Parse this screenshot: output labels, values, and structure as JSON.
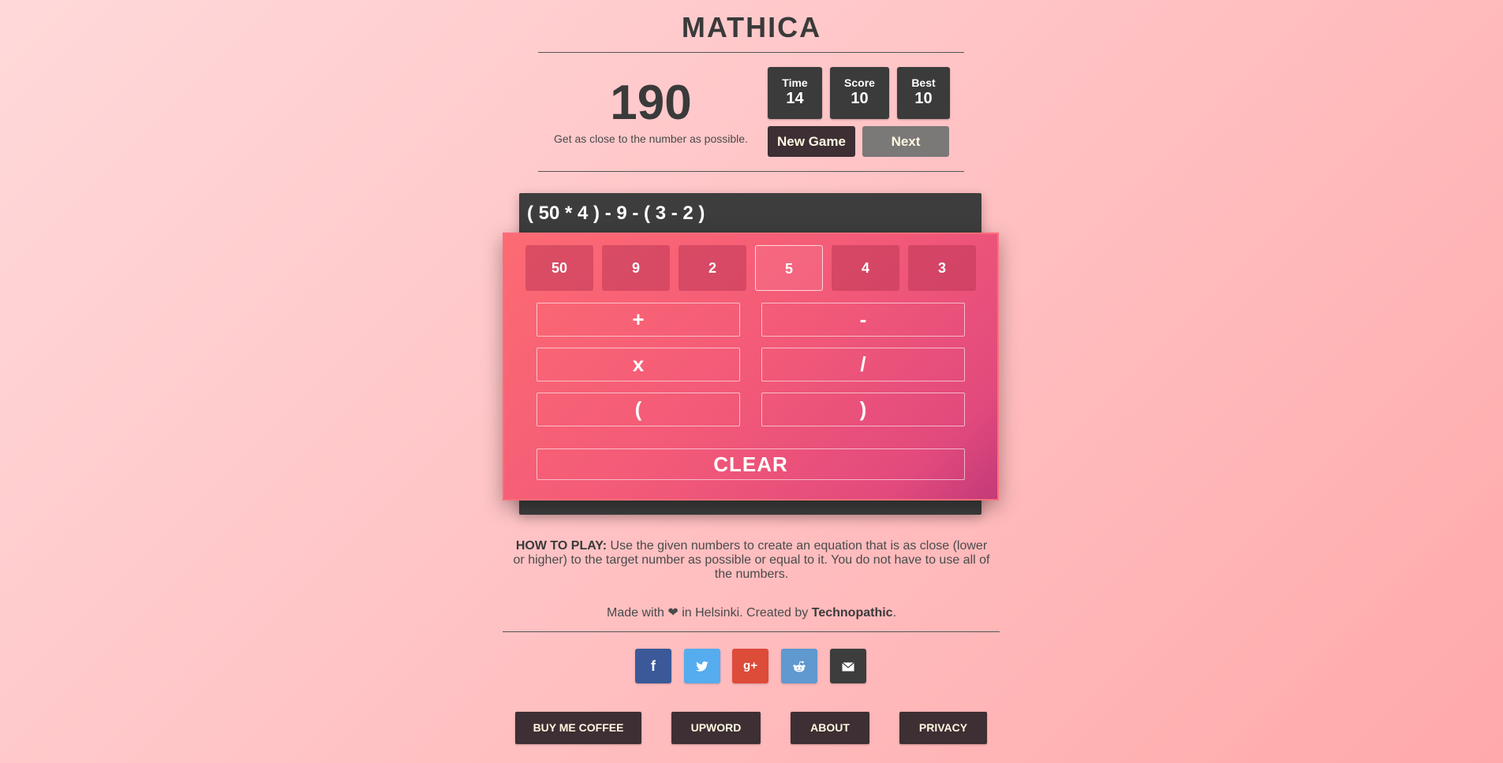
{
  "app": {
    "title": "MATHICA"
  },
  "game": {
    "target": "190",
    "hint": "Get as close to the number as possible.",
    "expression": "( 50 * 4 ) - 9 - ( 3 - 2 )",
    "numbers": [
      "50",
      "9",
      "2",
      "5",
      "4",
      "3"
    ],
    "selected_number_index": 3,
    "operators": {
      "plus": "+",
      "minus": "-",
      "times": "x",
      "divide": "/",
      "open_paren": "(",
      "close_paren": ")"
    },
    "clear_label": "CLEAR"
  },
  "stats": {
    "time_label": "Time",
    "time_value": "14",
    "score_label": "Score",
    "score_value": "10",
    "best_label": "Best",
    "best_value": "10"
  },
  "controls": {
    "new_game_label": "New Game",
    "next_label": "Next"
  },
  "howto": {
    "heading": "HOW TO PLAY:",
    "text": " Use the given numbers to create an equation that is as close (lower or higher) to the target number as possible or equal to it. You do not have to use all of the numbers."
  },
  "credits": {
    "prefix": "Made with",
    "middle": " in Helsinki. Created by ",
    "author": "Technopathic",
    "suffix": "."
  },
  "share": [
    {
      "name": "facebook",
      "icon": "facebook-icon",
      "color": "#3b5998"
    },
    {
      "name": "twitter",
      "icon": "twitter-icon",
      "color": "#55acee"
    },
    {
      "name": "google-plus",
      "icon": "google-plus-icon",
      "color": "#dd4b39"
    },
    {
      "name": "reddit",
      "icon": "reddit-icon",
      "color": "#5f99cf"
    },
    {
      "name": "email",
      "icon": "mail-icon",
      "color": "#3d3d3d"
    }
  ],
  "footer": {
    "coffee": "BUY ME COFFEE",
    "upword": "UPWORD",
    "about": "ABOUT",
    "privacy": "PRIVACY"
  },
  "colors": {
    "panel_accent": "#f35a78",
    "dark": "#3d2f33",
    "expression_bg": "#3d3d3d"
  }
}
